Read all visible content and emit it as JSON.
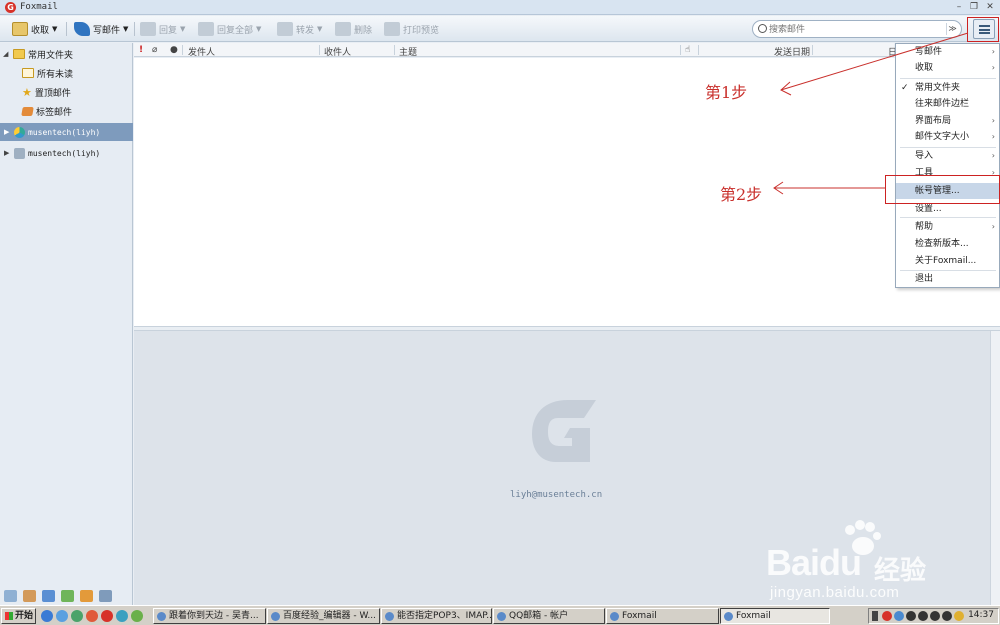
{
  "window": {
    "title": "Foxmail",
    "logo_letter": "G"
  },
  "toolbar": {
    "receive": "收取",
    "compose": "写邮件",
    "reply": "回复",
    "reply_all": "回复全部",
    "forward": "转发",
    "delete": "删除",
    "print_preview": "打印预览"
  },
  "search": {
    "placeholder": "搜索邮件"
  },
  "sidebar": {
    "folder_group": "常用文件夹",
    "items": [
      "所有未读",
      "置顶邮件",
      "标签邮件"
    ],
    "accounts": [
      "musentech(liyh)",
      "musentech(liyh)"
    ]
  },
  "list_header": {
    "flag": "!",
    "from": "发件人",
    "to": "收件人",
    "subject": "主题",
    "send_date": "发送日期",
    "date_short": "日"
  },
  "preview": {
    "email": "liyh@musentech.cn"
  },
  "menu": {
    "items": [
      {
        "label": "写邮件",
        "submenu": true
      },
      {
        "label": "收取",
        "submenu": true
      },
      {
        "label": "常用文件夹",
        "checked": true
      },
      {
        "label": "往来邮件边栏"
      },
      {
        "label": "界面布局",
        "submenu": true
      },
      {
        "label": "邮件文字大小",
        "submenu": true
      },
      {
        "label": "导入",
        "submenu": true
      },
      {
        "label": "工具",
        "submenu": true
      },
      {
        "label": "帐号管理...",
        "highlighted": true
      },
      {
        "label": "设置..."
      },
      {
        "label": "帮助",
        "submenu": true
      },
      {
        "label": "检查新版本..."
      },
      {
        "label": "关于Foxmail..."
      },
      {
        "label": "退出"
      }
    ]
  },
  "annotations": {
    "step1": "第1步",
    "step2": "第2步"
  },
  "watermark": {
    "brand": "Baidu",
    "brand_cn": "经验",
    "url": "jingyan.baidu.com"
  },
  "taskbar": {
    "start": "开始",
    "tasks": [
      "跟着你到天边 - 吴青...",
      "百度经验_编辑器 - W...",
      "能否指定POP3、IMAP...",
      "QQ邮箱 - 帐户",
      "Foxmail",
      "Foxmail"
    ],
    "clock": "14:37"
  },
  "colors": {
    "accent": "#7e9bbd",
    "annotation": "#c9302c",
    "logo": "#d73229"
  }
}
